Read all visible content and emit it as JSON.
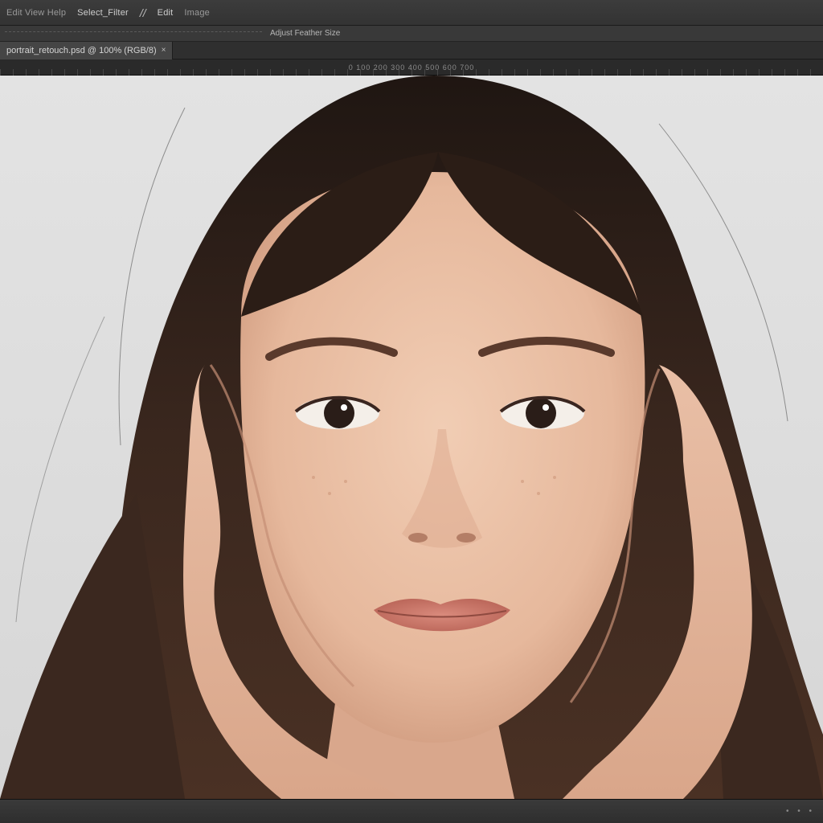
{
  "menubar": {
    "items": [
      "Edit View Help",
      "Select_Filter",
      "Edit",
      "Image"
    ]
  },
  "optionsbar": {
    "text": "Adjust Feather Size"
  },
  "tabbar": {
    "tab_label": "portrait_retouch.psd @ 100% (RGB/8)",
    "close_glyph": "×"
  },
  "ruler": {
    "label": "0 100 200 300 400 500 600 700"
  },
  "canvas": {
    "image_icon": "portrait-photo",
    "colors": {
      "background": "#dedede",
      "hair": "#2a1d17",
      "hair_highlight": "#5a3a2a",
      "skin": "#e8bfa4",
      "skin_shadow": "#c98f72",
      "lips": "#c86f62"
    }
  },
  "statusbar": {
    "dots": "• • •"
  }
}
